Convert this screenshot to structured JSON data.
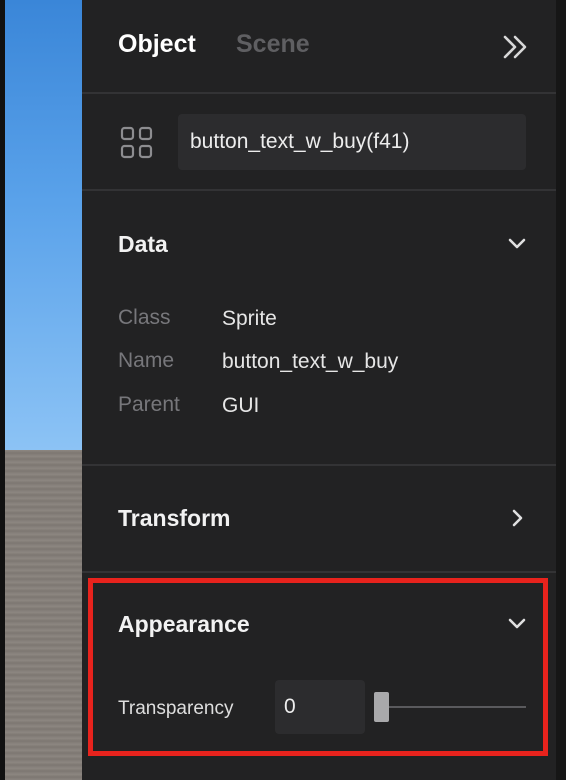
{
  "tabs": [
    {
      "label": "Object",
      "active": true
    },
    {
      "label": "Scene",
      "active": false
    }
  ],
  "object_name": "button_text_w_buy(f41)",
  "sections": {
    "data": {
      "title": "Data",
      "expanded": true,
      "properties": [
        {
          "key": "Class",
          "value": "Sprite"
        },
        {
          "key": "Name",
          "value": "button_text_w_buy"
        },
        {
          "key": "Parent",
          "value": "GUI"
        }
      ]
    },
    "transform": {
      "title": "Transform",
      "expanded": false
    },
    "appearance": {
      "title": "Appearance",
      "expanded": true,
      "transparency_label": "Transparency",
      "transparency_value": "0",
      "transparency_slider_fraction": 0
    }
  },
  "colors": {
    "panel": "#222223",
    "active_tab": "#ffffff",
    "inactive_tab": "#5f5f62",
    "highlight": "#e8231d"
  }
}
